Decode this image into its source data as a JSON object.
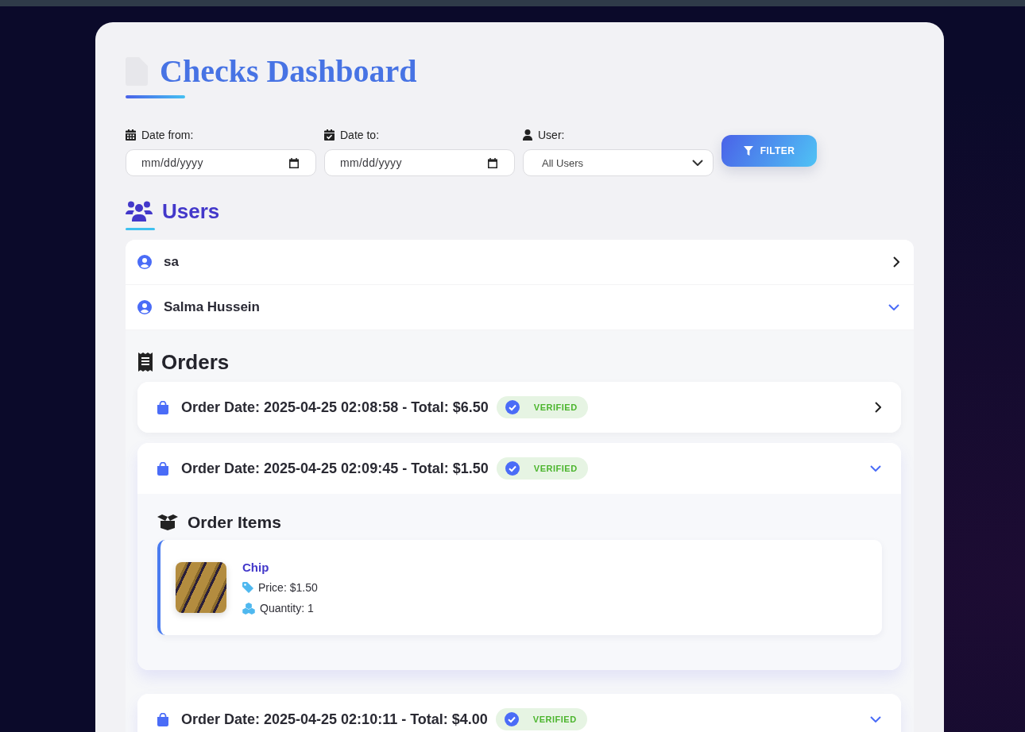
{
  "header": {
    "title": "Checks Dashboard"
  },
  "filters": {
    "fields": [
      {
        "kind": "date",
        "label": "Date from:",
        "placeholder": "mm/dd/yyyy"
      },
      {
        "kind": "date",
        "label": "Date to:",
        "placeholder": "mm/dd/yyyy"
      },
      {
        "kind": "select",
        "label": "User:",
        "value": "All Users"
      }
    ],
    "button": "FILTER"
  },
  "users": {
    "title": "Users",
    "items": [
      {
        "name": "sa",
        "expanded": false
      },
      {
        "name": "Salma Hussein",
        "expanded": true,
        "orders": {
          "title": "Orders",
          "items": [
            {
              "label": "Order Date: 2025-04-25 02:08:58 - Total: $6.50",
              "status": "VERIFIED",
              "expanded": false
            },
            {
              "label": "Order Date: 2025-04-25 02:09:45 - Total: $1.50",
              "status": "VERIFIED",
              "expanded": true,
              "details": {
                "title": "Order Items",
                "items": [
                  {
                    "name": "Chip",
                    "price": "Price: $1.50",
                    "quantity": "Quantity: 1"
                  }
                ]
              }
            },
            {
              "label": "Order Date: 2025-04-25 02:10:11 - Total: $4.00",
              "status": "VERIFIED",
              "expanded": true
            }
          ]
        }
      }
    ]
  }
}
